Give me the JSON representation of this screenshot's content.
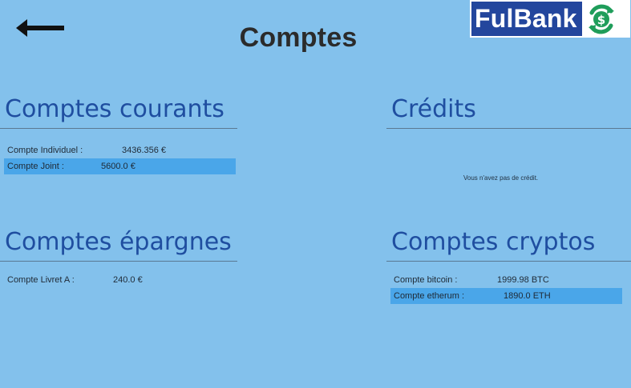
{
  "header": {
    "title": "Comptes",
    "back_icon": "arrow-left-icon",
    "logo_text": "FulBank",
    "logo_icon": "dollar-refresh-icon"
  },
  "sections": {
    "courants": {
      "title": "Comptes courants",
      "rows": [
        {
          "label": "Compte Individuel :",
          "value": "3436.356 €",
          "selected": false
        },
        {
          "label": "Compte Joint :",
          "value": "5600.0 €",
          "selected": true
        }
      ]
    },
    "credits": {
      "title": "Crédits",
      "empty_message": "Vous n'avez pas de crédit."
    },
    "epargnes": {
      "title": "Comptes épargnes",
      "rows": [
        {
          "label": "Compte Livret A :",
          "value": "240.0 €",
          "selected": false
        }
      ]
    },
    "cryptos": {
      "title": "Comptes cryptos",
      "rows": [
        {
          "label": "Compte bitcoin :",
          "value": "1999.98 BTC",
          "selected": false
        },
        {
          "label": "Compte etherum :",
          "value": "1890.0 ETH",
          "selected": true
        }
      ]
    }
  },
  "colors": {
    "background": "#83c1ec",
    "selected_row": "#4aa6e9",
    "section_title": "#1f4ea0",
    "logo_bg": "#23469d",
    "logo_icon": "#1f9d5a"
  }
}
